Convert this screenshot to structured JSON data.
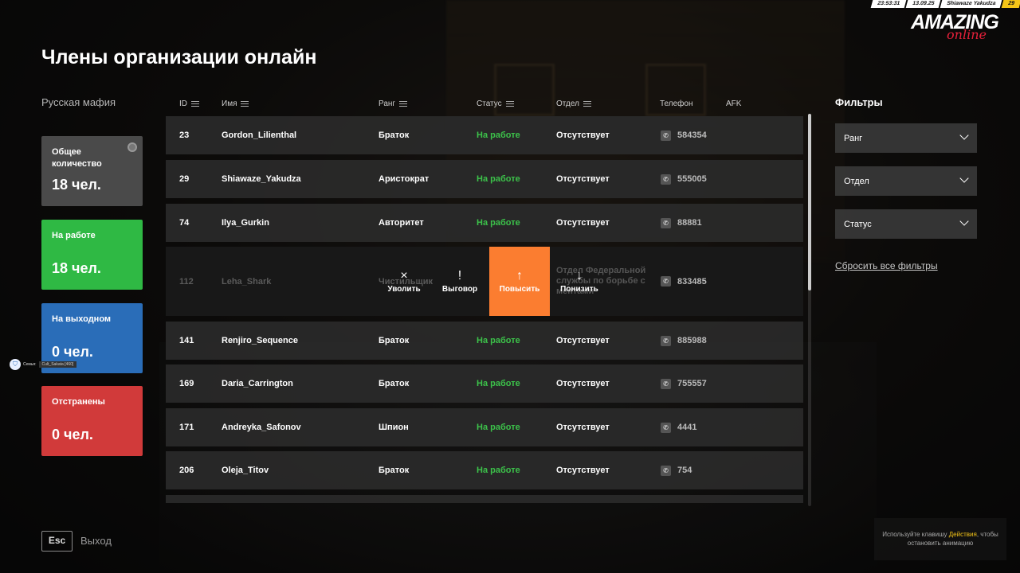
{
  "hud": {
    "time": "23:53:31",
    "date": "13.09.25",
    "player": "Shiawaze Yakudza",
    "level": "29"
  },
  "logo": {
    "main": "AMAZING",
    "sub": "online"
  },
  "page": {
    "title": "Члены организации онлайн",
    "organization": "Русская мафия"
  },
  "stats": {
    "total": {
      "label": "Общее количество",
      "value": "18 чел."
    },
    "at_work": {
      "label": "На работе",
      "value": "18 чел."
    },
    "day_off": {
      "label": "На выходном",
      "value": "0 чел."
    },
    "suspended": {
      "label": "Отстранены",
      "value": "0 чел."
    }
  },
  "family_tag": {
    "label": "Семья:",
    "name": "Cult_Sakata [460]"
  },
  "table": {
    "headers": {
      "id": "ID",
      "name": "Имя",
      "rank": "Ранг",
      "status": "Статус",
      "department": "Отдел",
      "phone": "Телефон",
      "afk": "AFK"
    },
    "rows": [
      {
        "id": "23",
        "name": "Gordon_Lilienthal",
        "rank": "Браток",
        "status": "На работе",
        "department": "Отсутствует",
        "phone": "584354"
      },
      {
        "id": "29",
        "name": "Shiawaze_Yakudza",
        "rank": "Аристократ",
        "status": "На работе",
        "department": "Отсутствует",
        "phone": "555005"
      },
      {
        "id": "74",
        "name": "Ilya_Gurkin",
        "rank": "Авторитет",
        "status": "На работе",
        "department": "Отсутствует",
        "phone": "88881"
      },
      {
        "id": "112",
        "name": "Leha_Shark",
        "rank": "Чистильщик",
        "status": "",
        "department": "Отдел Федеральной службы по борьбе с ментами",
        "phone": "833485"
      },
      {
        "id": "141",
        "name": "Renjiro_Sequence",
        "rank": "Браток",
        "status": "На работе",
        "department": "Отсутствует",
        "phone": "885988"
      },
      {
        "id": "169",
        "name": "Daria_Carrington",
        "rank": "Браток",
        "status": "На работе",
        "department": "Отсутствует",
        "phone": "755557"
      },
      {
        "id": "171",
        "name": "Andreyka_Safonov",
        "rank": "Шпион",
        "status": "На работе",
        "department": "Отсутствует",
        "phone": "4441"
      },
      {
        "id": "206",
        "name": "Oleja_Titov",
        "rank": "Браток",
        "status": "На работе",
        "department": "Отсутствует",
        "phone": "754"
      }
    ],
    "actions": {
      "fire": {
        "icon": "×",
        "label": "Уволить"
      },
      "reprimand": {
        "icon": "!",
        "label": "Выговор"
      },
      "promote": {
        "icon": "↑",
        "label": "Повысить"
      },
      "demote": {
        "icon": "↓",
        "label": "Понизить"
      }
    }
  },
  "filters": {
    "title": "Фильтры",
    "rank": "Ранг",
    "department": "Отдел",
    "status": "Статус",
    "reset": "Сбросить все фильтры"
  },
  "footer": {
    "esc": "Esc",
    "exit": "Выход"
  },
  "hint": {
    "before": "Используйте клавишу ",
    "key": "Действия",
    "after": ", чтобы остановить анимацию"
  },
  "colors": {
    "accent": "#fb7d30",
    "status_green": "#3cc24a",
    "card_gray": "#4a4a4a",
    "card_green": "#2fb944",
    "card_blue": "#2a6db8",
    "card_red": "#d13a3a"
  }
}
